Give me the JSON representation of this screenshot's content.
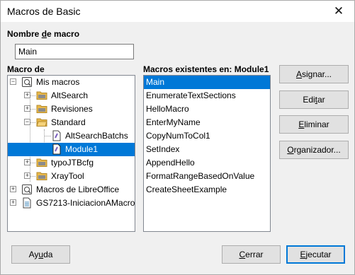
{
  "window": {
    "title": "Macros de Basic",
    "close_glyph": "✕"
  },
  "macro_name": {
    "label_pre": "Nombre ",
    "label_acc": "d",
    "label_post": "e macro",
    "value": "Main"
  },
  "tree": {
    "label": "Macro de",
    "items": [
      {
        "label": "Mis macros",
        "icon": "macro-library-icon",
        "expander": "−"
      },
      {
        "label": "AltSearch",
        "icon": "folder-icon",
        "expander": "+"
      },
      {
        "label": "Revisiones",
        "icon": "folder-icon",
        "expander": "+"
      },
      {
        "label": "Standard",
        "icon": "folder-open-icon",
        "expander": "−"
      },
      {
        "label": "AltSearchBatchs",
        "icon": "module-icon"
      },
      {
        "label": "Module1",
        "icon": "module-icon",
        "selected": true
      },
      {
        "label": "typoJTBcfg",
        "icon": "folder-icon",
        "expander": "+"
      },
      {
        "label": "XrayTool",
        "icon": "folder-icon",
        "expander": "+"
      },
      {
        "label": "Macros de LibreOffice",
        "icon": "macro-library-icon",
        "expander": "+"
      },
      {
        "label": "GS7213-IniciacionAMacros",
        "icon": "document-icon",
        "expander": "+"
      }
    ]
  },
  "list": {
    "label": "Macros existentes en: Module1",
    "items": [
      "Main",
      "EnumerateTextSections",
      "HelloMacro",
      "EnterMyName",
      "CopyNumToCol1",
      "SetIndex",
      "AppendHello",
      "FormatRangeBasedOnValue",
      "CreateSheetExample"
    ]
  },
  "buttons": {
    "asignar": {
      "pre": "",
      "acc": "A",
      "post": "signar..."
    },
    "editar": {
      "pre": "Edi",
      "acc": "t",
      "post": "ar"
    },
    "eliminar": {
      "pre": "",
      "acc": "E",
      "post": "liminar"
    },
    "organizador": {
      "pre": "",
      "acc": "O",
      "post": "rganizador..."
    },
    "ayuda": {
      "pre": "Ay",
      "acc": "u",
      "post": "da"
    },
    "cerrar": {
      "pre": "",
      "acc": "C",
      "post": "errar"
    },
    "ejecutar": {
      "pre": "",
      "acc": "E",
      "post": "jecutar"
    }
  },
  "colors": {
    "selection": "#0078d7",
    "dialog_bg": "#f0f0f0",
    "folder": "#e8b84a"
  }
}
